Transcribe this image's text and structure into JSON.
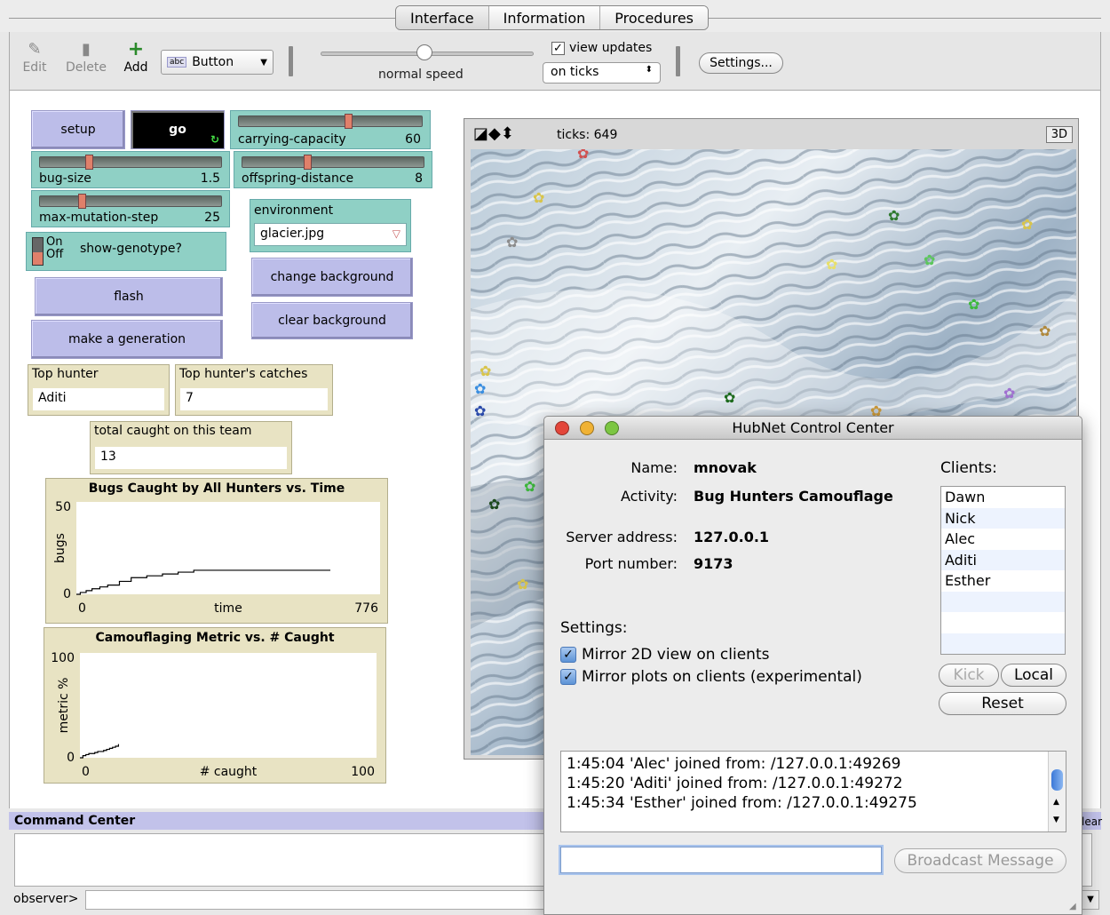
{
  "tabs": [
    "Interface",
    "Information",
    "Procedures"
  ],
  "toolbar": {
    "edit_label": "Edit",
    "delete_label": "Delete",
    "add_label": "Add",
    "widget_type": "Button",
    "widget_type_icon": "abc",
    "speed_label": "normal speed",
    "view_updates_label": "view updates",
    "update_mode": "on ticks",
    "settings_label": "Settings..."
  },
  "widgets": {
    "setup_label": "setup",
    "go_label": "go",
    "carrying_capacity": {
      "label": "carrying-capacity",
      "value": "60",
      "level": 0.6
    },
    "bug_size": {
      "label": "bug-size",
      "value": "1.5",
      "level": 0.28
    },
    "offspring_distance": {
      "label": "offspring-distance",
      "value": "8",
      "level": 0.38
    },
    "max_mutation_step": {
      "label": "max-mutation-step",
      "value": "25",
      "level": 0.25
    },
    "show_genotype": {
      "on": "On",
      "off": "Off",
      "label": "show-genotype?"
    },
    "environment": {
      "label": "environment",
      "value": "glacier.jpg"
    },
    "change_background_label": "change background",
    "clear_background_label": "clear background",
    "flash_label": "flash",
    "make_generation_label": "make a generation",
    "top_hunter": {
      "label": "Top hunter",
      "value": "Aditi"
    },
    "top_hunter_catches": {
      "label": "Top hunter's catches",
      "value": "7"
    },
    "total_caught": {
      "label": "total caught on this team",
      "value": "13"
    }
  },
  "view": {
    "ticks_label": "ticks: 649",
    "three_d_label": "3D"
  },
  "command_center": {
    "title": "Command Center",
    "observer_label": "observer>",
    "clear_label": "lear"
  },
  "hubnet": {
    "title": "HubNet Control Center",
    "name_label": "Name:",
    "name": "mnovak",
    "activity_label": "Activity:",
    "activity": "Bug Hunters Camouflage",
    "server_label": "Server address:",
    "server": "127.0.0.1",
    "port_label": "Port number:",
    "port": "9173",
    "clients_label": "Clients:",
    "clients": [
      "Dawn",
      "Nick",
      "Alec",
      "Aditi",
      "Esther"
    ],
    "kick_label": "Kick",
    "local_label": "Local",
    "reset_label": "Reset",
    "settings_label": "Settings:",
    "mirror_view_label": "Mirror 2D view on clients",
    "mirror_plots_label": "Mirror plots on clients (experimental)",
    "log": [
      "1:45:04  'Alec' joined from: /127.0.0.1:49269",
      "1:45:20  'Aditi' joined from: /127.0.0.1:49272",
      "1:45:34  'Esther' joined from: /127.0.0.1:49275"
    ],
    "broadcast_label": "Broadcast Message"
  },
  "chart_data": [
    {
      "type": "line",
      "title": "Bugs Caught by All Hunters vs. Time",
      "xlabel": "time",
      "ylabel": "bugs",
      "xlim": [
        0,
        776
      ],
      "ylim": [
        0,
        50
      ],
      "x_tick_labels": [
        "0",
        "776"
      ],
      "y_tick_labels": [
        "0",
        "50"
      ],
      "series": [
        {
          "x": [
            0,
            10,
            25,
            40,
            60,
            80,
            110,
            140,
            180,
            220,
            260,
            300,
            340,
            380,
            420,
            460,
            500,
            540,
            580,
            620,
            649
          ],
          "y": [
            0,
            1,
            2,
            3,
            4,
            5,
            7,
            9,
            10,
            11,
            12,
            13,
            13,
            13,
            13,
            13,
            13,
            13,
            13,
            13,
            13
          ]
        }
      ]
    },
    {
      "type": "line",
      "title": "Camouflaging Metric vs. # Caught",
      "xlabel": "# caught",
      "ylabel": "metric %",
      "xlim": [
        0,
        100
      ],
      "ylim": [
        0,
        100
      ],
      "x_tick_labels": [
        "0",
        "100"
      ],
      "y_tick_labels": [
        "0",
        "100"
      ],
      "series": [
        {
          "x": [
            0,
            1,
            2,
            3,
            4,
            5,
            6,
            7,
            8,
            9,
            10,
            11,
            12,
            13
          ],
          "y": [
            0,
            2,
            3,
            4,
            4,
            5,
            6,
            6,
            7,
            8,
            9,
            10,
            11,
            13
          ]
        }
      ]
    }
  ]
}
